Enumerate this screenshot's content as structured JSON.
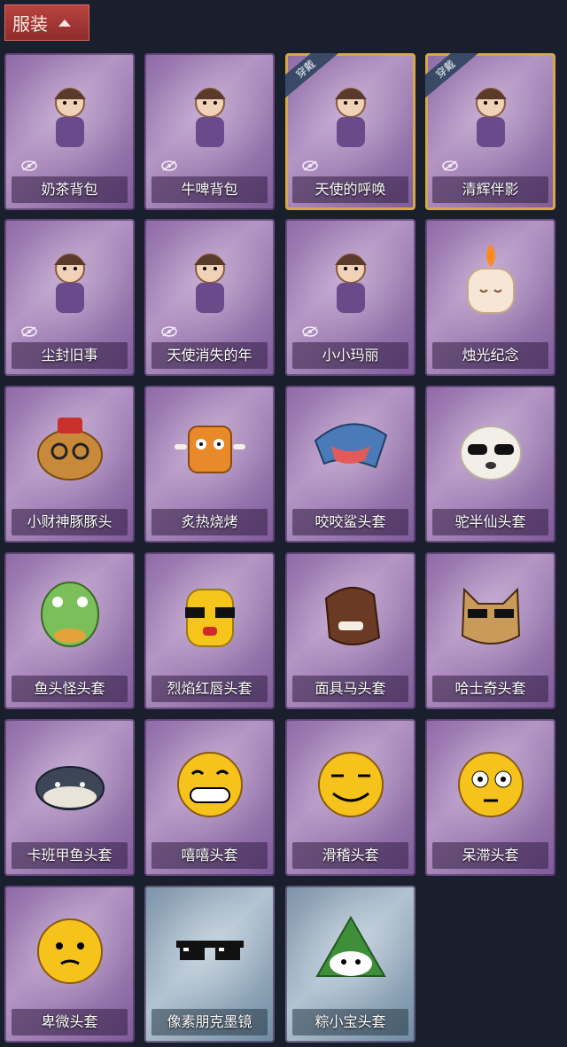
{
  "header": {
    "title": "服装"
  },
  "items": [
    {
      "label": "奶茶背包",
      "hidden": true,
      "worn": false,
      "variant": "purple",
      "icon": "milk-tea-backpack-icon"
    },
    {
      "label": "牛啤背包",
      "hidden": true,
      "worn": false,
      "variant": "purple",
      "icon": "beer-backpack-icon"
    },
    {
      "label": "天使的呼唤",
      "hidden": true,
      "worn": true,
      "badge": "穿戴",
      "variant": "purple",
      "icon": "angel-call-icon"
    },
    {
      "label": "清辉伴影",
      "hidden": true,
      "worn": true,
      "badge": "穿戴",
      "variant": "purple",
      "icon": "clear-radiance-icon"
    },
    {
      "label": "尘封旧事",
      "hidden": true,
      "worn": false,
      "variant": "purple",
      "icon": "dusty-past-icon"
    },
    {
      "label": "天使消失的年",
      "hidden": true,
      "worn": false,
      "variant": "purple",
      "icon": "angel-vanished-icon"
    },
    {
      "label": "小小玛丽",
      "hidden": true,
      "worn": false,
      "variant": "purple",
      "icon": "little-mary-icon"
    },
    {
      "label": "烛光纪念",
      "hidden": false,
      "worn": false,
      "variant": "purple",
      "icon": "candle-icon"
    },
    {
      "label": "小财神豚豚头",
      "hidden": false,
      "worn": false,
      "variant": "purple",
      "icon": "capybara-head-icon"
    },
    {
      "label": "炙热烧烤",
      "hidden": false,
      "worn": false,
      "variant": "purple",
      "icon": "bbq-icon"
    },
    {
      "label": "咬咬鲨头套",
      "hidden": false,
      "worn": false,
      "variant": "purple",
      "icon": "shark-head-icon"
    },
    {
      "label": "驼半仙头套",
      "hidden": false,
      "worn": false,
      "variant": "purple",
      "icon": "alpaca-head-icon"
    },
    {
      "label": "鱼头怪头套",
      "hidden": false,
      "worn": false,
      "variant": "purple",
      "icon": "fish-head-icon"
    },
    {
      "label": "烈焰红唇头套",
      "hidden": false,
      "worn": false,
      "variant": "purple",
      "icon": "red-lips-head-icon"
    },
    {
      "label": "面具马头套",
      "hidden": false,
      "worn": false,
      "variant": "purple",
      "icon": "horse-head-icon"
    },
    {
      "label": "哈士奇头套",
      "hidden": false,
      "worn": false,
      "variant": "purple",
      "icon": "husky-head-icon"
    },
    {
      "label": "卡班甲鱼头套",
      "hidden": false,
      "worn": false,
      "variant": "purple",
      "icon": "turtle-head-icon"
    },
    {
      "label": "嘻嘻头套",
      "hidden": false,
      "worn": false,
      "variant": "purple",
      "icon": "grin-emoji-icon"
    },
    {
      "label": "滑稽头套",
      "hidden": false,
      "worn": false,
      "variant": "purple",
      "icon": "silly-emoji-icon"
    },
    {
      "label": "呆滞头套",
      "hidden": false,
      "worn": false,
      "variant": "purple",
      "icon": "dazed-emoji-icon"
    },
    {
      "label": "卑微头套",
      "hidden": false,
      "worn": false,
      "variant": "purple",
      "icon": "humble-emoji-icon"
    },
    {
      "label": "像素朋克墨镜",
      "hidden": false,
      "worn": false,
      "variant": "blue",
      "icon": "pixel-sunglasses-icon"
    },
    {
      "label": "粽小宝头套",
      "hidden": false,
      "worn": false,
      "variant": "blue",
      "icon": "zongzi-head-icon"
    }
  ]
}
